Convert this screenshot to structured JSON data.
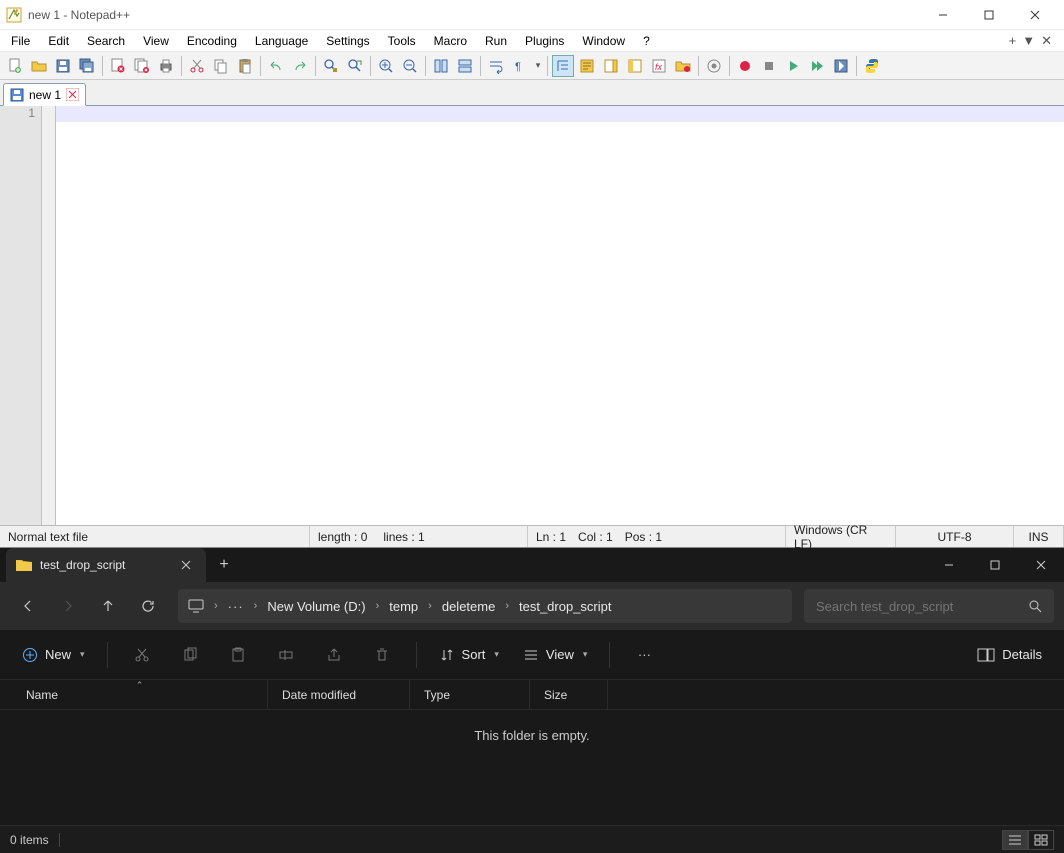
{
  "notepadpp": {
    "title": "new 1 - Notepad++",
    "menus": [
      "File",
      "Edit",
      "Search",
      "View",
      "Encoding",
      "Language",
      "Settings",
      "Tools",
      "Macro",
      "Run",
      "Plugins",
      "Window",
      "?"
    ],
    "menu_right": [
      "+",
      "▼",
      "✕"
    ],
    "tab": {
      "label": "new 1"
    },
    "gutter": {
      "line1": "1"
    },
    "status": {
      "type": "Normal text file",
      "length": "length : 0",
      "lines": "lines : 1",
      "ln": "Ln : 1",
      "col": "Col : 1",
      "pos": "Pos : 1",
      "eol": "Windows (CR LF)",
      "enc": "UTF-8",
      "ovr": "INS"
    }
  },
  "explorer": {
    "tab_title": "test_drop_script",
    "breadcrumb": [
      "New Volume (D:)",
      "temp",
      "deleteme",
      "test_drop_script"
    ],
    "search_placeholder": "Search test_drop_script",
    "toolbar": {
      "new": "New",
      "sort": "Sort",
      "view": "View",
      "details": "Details"
    },
    "columns": {
      "name": "Name",
      "date": "Date modified",
      "type": "Type",
      "size": "Size"
    },
    "empty": "This folder is empty.",
    "status": "0 items"
  }
}
